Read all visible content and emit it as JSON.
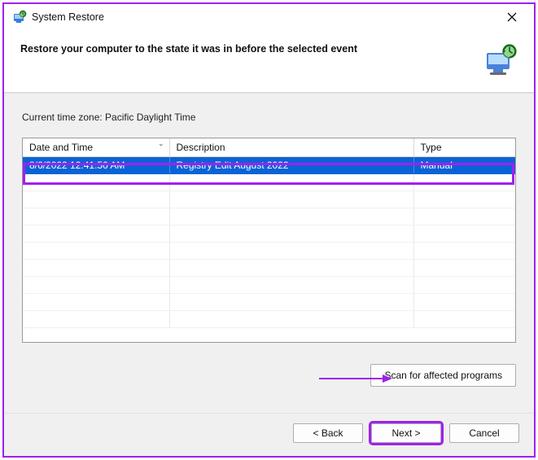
{
  "window": {
    "title": "System Restore"
  },
  "header": {
    "heading": "Restore your computer to the state it was in before the selected event"
  },
  "content": {
    "timezone_label": "Current time zone: Pacific Daylight Time",
    "columns": {
      "date": "Date and Time",
      "description": "Description",
      "type": "Type"
    },
    "rows": [
      {
        "date": "8/6/2022 12:41:50 AM",
        "description": "Registry Edit August 2022",
        "type": "Manual",
        "selected": true
      }
    ],
    "scan_button": "Scan for affected programs"
  },
  "footer": {
    "back": "< Back",
    "next": "Next >",
    "cancel": "Cancel"
  }
}
